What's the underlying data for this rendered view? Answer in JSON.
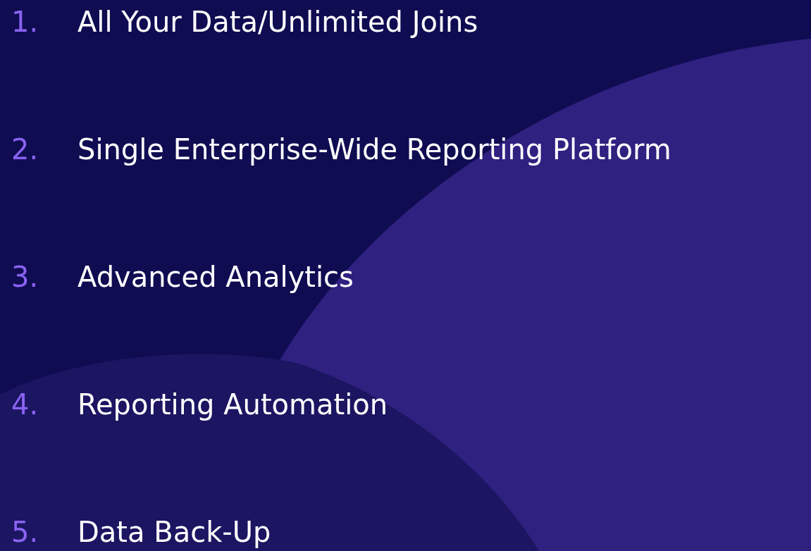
{
  "items": [
    {
      "number": "1.",
      "label": "All Your Data/Unlimited Joins"
    },
    {
      "number": "2.",
      "label": "Single Enterprise-Wide Reporting Platform"
    },
    {
      "number": "3.",
      "label": "Advanced Analytics"
    },
    {
      "number": "4.",
      "label": "Reporting Automation"
    },
    {
      "number": "5.",
      "label": "Data Back-Up"
    }
  ]
}
